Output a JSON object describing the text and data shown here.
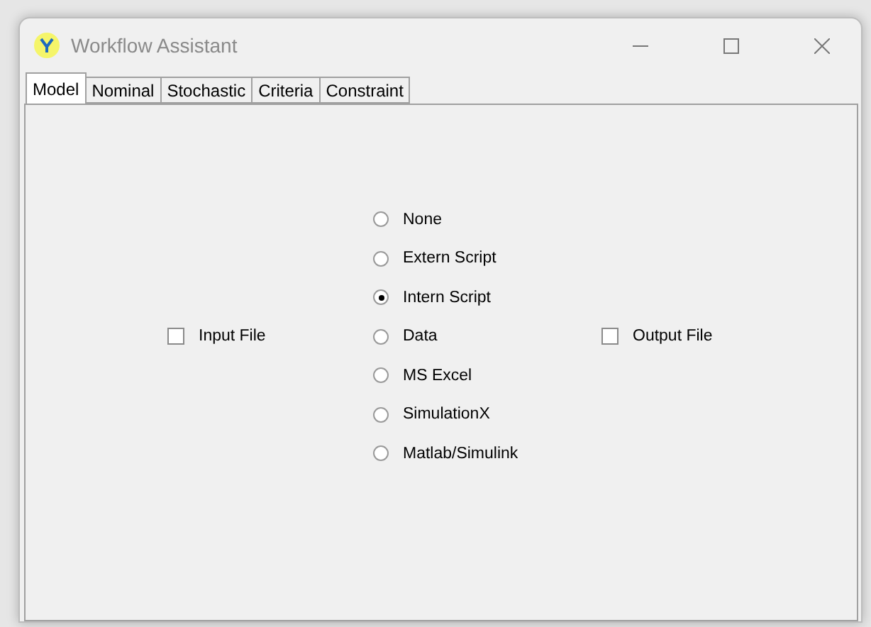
{
  "window": {
    "title": "Workflow Assistant"
  },
  "tabs": [
    {
      "label": "Model",
      "selected": true
    },
    {
      "label": "Nominal",
      "selected": false
    },
    {
      "label": "Stochastic",
      "selected": false
    },
    {
      "label": "Criteria",
      "selected": false
    },
    {
      "label": "Constraint",
      "selected": false
    }
  ],
  "input_file": {
    "label": "Input File",
    "checked": false
  },
  "model_types": [
    {
      "label": "None",
      "selected": false
    },
    {
      "label": "Extern Script",
      "selected": false
    },
    {
      "label": "Intern Script",
      "selected": true
    },
    {
      "label": "Data",
      "selected": false
    },
    {
      "label": "MS Excel",
      "selected": false
    },
    {
      "label": "SimulationX",
      "selected": false
    },
    {
      "label": "Matlab/Simulink",
      "selected": false
    }
  ],
  "output_file": {
    "label": "Output File",
    "checked": false
  }
}
